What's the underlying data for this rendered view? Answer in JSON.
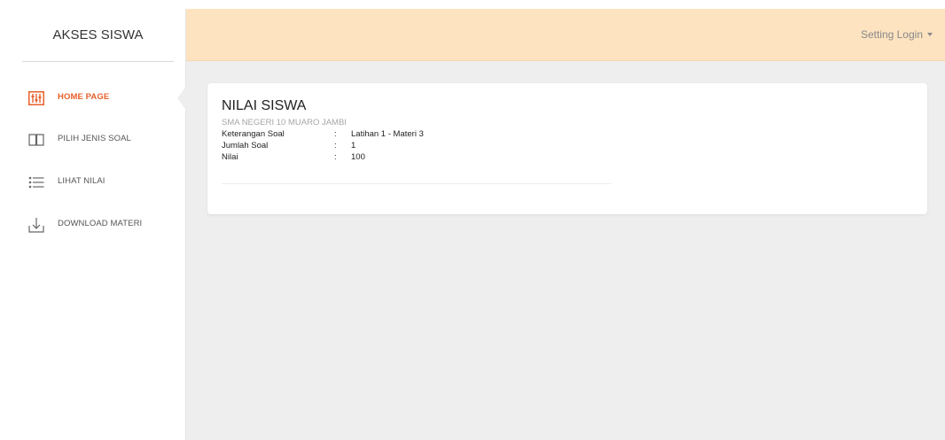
{
  "sidebar": {
    "brand": "AKSES SISWA",
    "items": [
      {
        "label": "HOME PAGE",
        "icon": "equalizer-icon"
      },
      {
        "label": "PILIH JENIS SOAL",
        "icon": "book-icon"
      },
      {
        "label": "LIHAT NILAI",
        "icon": "list-icon"
      },
      {
        "label": "DOWNLOAD MATERI",
        "icon": "download-icon"
      }
    ]
  },
  "header": {
    "user_menu": "Setting Login"
  },
  "card": {
    "title": "NILAI SISWA",
    "school": "SMA NEGERI 10 MUARO JAMBI",
    "rows": [
      {
        "label": "Keterangan Soal",
        "sep": ":",
        "value": "Latihan 1 - Materi 3"
      },
      {
        "label": "Jumlah Soal",
        "sep": ":",
        "value": "1"
      },
      {
        "label": "Nilai",
        "sep": ":",
        "value": "100"
      }
    ]
  },
  "colors": {
    "accent": "#e8602c",
    "topbar": "#fde3c0",
    "background": "#eeeeee"
  }
}
